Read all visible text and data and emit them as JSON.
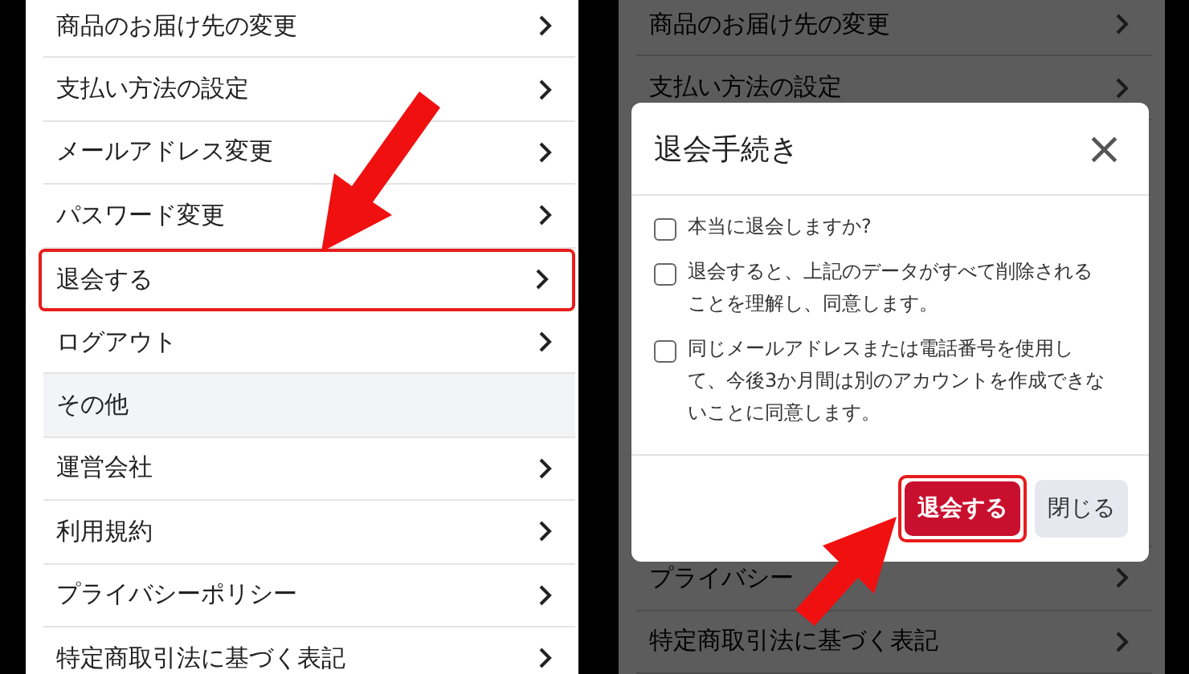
{
  "menu": [
    {
      "label": "商品のお届け先の変更",
      "kind": "item",
      "highlighted": false
    },
    {
      "label": "支払い方法の設定",
      "kind": "item",
      "highlighted": false
    },
    {
      "label": "メールアドレス変更",
      "kind": "item",
      "highlighted": false
    },
    {
      "label": "パスワード変更",
      "kind": "item",
      "highlighted": false
    },
    {
      "label": "退会する",
      "kind": "item",
      "highlighted": true
    },
    {
      "label": "ログアウト",
      "kind": "item",
      "highlighted": false
    },
    {
      "label": "その他",
      "kind": "section",
      "highlighted": false
    },
    {
      "label": "運営会社",
      "kind": "item",
      "highlighted": false
    },
    {
      "label": "利用規約",
      "kind": "item",
      "highlighted": false
    },
    {
      "label": "プライバシーポリシー",
      "kind": "item",
      "highlighted": false
    },
    {
      "label": "特定商取引法に基づく表記",
      "kind": "item",
      "highlighted": false
    }
  ],
  "background_top": [
    {
      "label": "商品のお届け先の変更"
    },
    {
      "label": "支払い方法の設定"
    }
  ],
  "background_bottom": [
    {
      "label": "プライバシー"
    },
    {
      "label": "特定商取引法に基づく表記"
    }
  ],
  "dialog": {
    "title": "退会手続き",
    "close": "×",
    "checks": [
      {
        "label": "本当に退会しますか?",
        "checked": false
      },
      {
        "label": "退会すると、上記のデータがすべて削除されることを理解し、同意します。",
        "checked": false
      },
      {
        "label": "同じメールアドレスまたは電話番号を使用して、今後3か月間は別のアカウントを作成できないことに同意します。",
        "checked": false
      }
    ],
    "confirm": {
      "label": "退会する",
      "highlighted": true
    },
    "cancel": {
      "label": "閉じる"
    }
  }
}
